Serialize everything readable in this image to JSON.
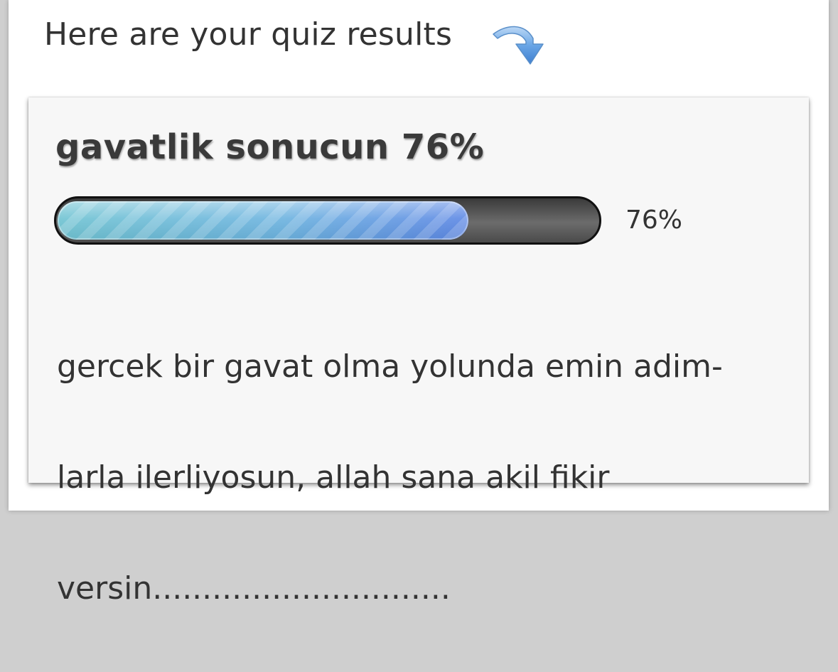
{
  "intro": {
    "text": "Here are your quiz results",
    "icon": "curved-arrow-down-icon"
  },
  "result": {
    "title": "gavatlik sonucun 76%",
    "progress_percent": 76,
    "progress_label": "76%",
    "description_lines": [
      "gercek bir gavat olma yolunda emin adim-",
      "larla ilerliyosun, allah sana akil fikir",
      "versin.............................."
    ]
  },
  "colors": {
    "fill_start": "#6fc3d2",
    "fill_end": "#5b86e4",
    "track": "#4a4a4a",
    "text": "#333333"
  }
}
